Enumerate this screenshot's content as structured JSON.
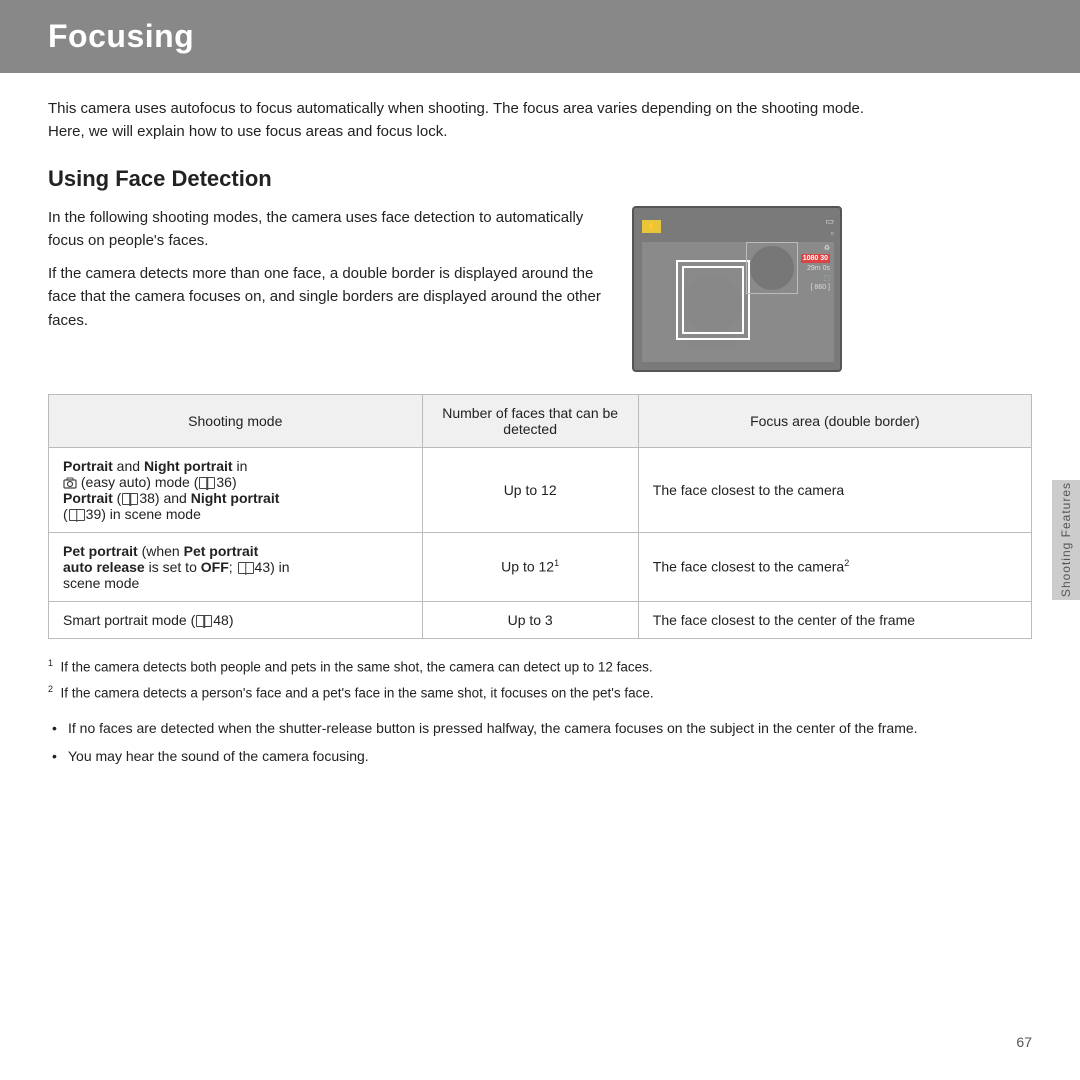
{
  "page": {
    "title": "Focusing",
    "number": "67"
  },
  "header": {
    "title": "Focusing"
  },
  "intro": {
    "text": "This camera uses autofocus to focus automatically when shooting. The focus area varies depending on the shooting mode. Here, we will explain how to use focus areas and focus lock."
  },
  "section": {
    "title": "Using Face Detection",
    "para1": "In the following shooting modes, the camera uses face detection to automatically focus on people's faces.",
    "para2": "If the camera detects more than one face, a double border is displayed around the face that the camera focuses on, and single borders are displayed around the other faces."
  },
  "table": {
    "headers": {
      "col1": "Shooting mode",
      "col2": "Number of faces that can be detected",
      "col3": "Focus area (double border)"
    },
    "rows": [
      {
        "shooting_mode_bold1": "Portrait",
        "shooting_mode_text1": " and ",
        "shooting_mode_bold2": "Night portrait",
        "shooting_mode_text2": " in",
        "shooting_mode_line2": "(easy auto) mode (",
        "shooting_mode_page2": "36)",
        "shooting_mode_line3_bold1": "Portrait",
        "shooting_mode_line3_text1": " (",
        "shooting_mode_line3_page1": "38) and ",
        "shooting_mode_line3_bold2": "Night portrait",
        "shooting_mode_line3_text2": "",
        "shooting_mode_line4": "(39) in scene mode",
        "face_count": "Up to 12",
        "focus_area": "The face closest to the camera"
      },
      {
        "shooting_mode_bold1": "Pet portrait",
        "shooting_mode_text1": " (when ",
        "shooting_mode_bold2": "Pet portrait",
        "shooting_mode_line2_bold": "auto release",
        "shooting_mode_line2_text": " is set to ",
        "shooting_mode_line2_bold2": "OFF",
        "shooting_mode_line2_text2": "; ",
        "shooting_mode_line2_page": "43) in",
        "shooting_mode_line3": "scene mode",
        "face_count": "Up to 12¹",
        "focus_area": "The face closest to the camera²"
      },
      {
        "shooting_mode_text": "Smart portrait mode (",
        "shooting_mode_page": "48)",
        "face_count": "Up to 3",
        "focus_area": "The face closest to the center of the frame"
      }
    ]
  },
  "footnotes": [
    {
      "number": "1",
      "text": "If the camera detects both people and pets in the same shot, the camera can detect up to 12 faces."
    },
    {
      "number": "2",
      "text": "If the camera detects a person’s face and a pet’s face in the same shot, it focuses on the pet’s face."
    }
  ],
  "bullets": [
    "If no faces are detected when the shutter-release button is pressed halfway, the camera focuses on the subject in the center of the frame.",
    "You may hear the sound of the camera focusing."
  ],
  "sidebar": {
    "label": "Shooting Features"
  }
}
